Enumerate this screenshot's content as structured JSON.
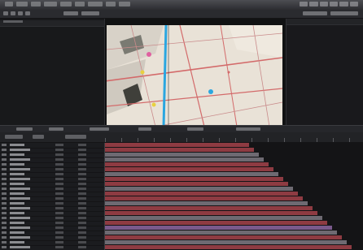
{
  "app": {
    "menu_items": 9,
    "has_clock_cluster": true
  },
  "colors": {
    "background": "#1e1f22",
    "viewer_bg": "#111213",
    "map_bg": "#e9e2d7",
    "route": "#2aa6e0",
    "road_red": "#d36a6a",
    "layer_band_red": "#8e3b42",
    "layer_band_gray": "#6e6a72",
    "layer_band_purple": "#7a5a8c"
  },
  "timeline": {
    "layer_count": 22,
    "bands": [
      {
        "color": "red"
      },
      {
        "color": "red"
      },
      {
        "color": "gray"
      },
      {
        "color": "gray"
      },
      {
        "color": "red"
      },
      {
        "color": "red"
      },
      {
        "color": "gray"
      },
      {
        "color": "red"
      },
      {
        "color": "red"
      },
      {
        "color": "gray"
      },
      {
        "color": "red"
      },
      {
        "color": "red"
      },
      {
        "color": "gray"
      },
      {
        "color": "red"
      },
      {
        "color": "red"
      },
      {
        "color": "gray"
      },
      {
        "color": "red"
      },
      {
        "color": "purple"
      },
      {
        "color": "gray"
      },
      {
        "color": "red"
      },
      {
        "color": "gray"
      },
      {
        "color": "red"
      }
    ]
  }
}
